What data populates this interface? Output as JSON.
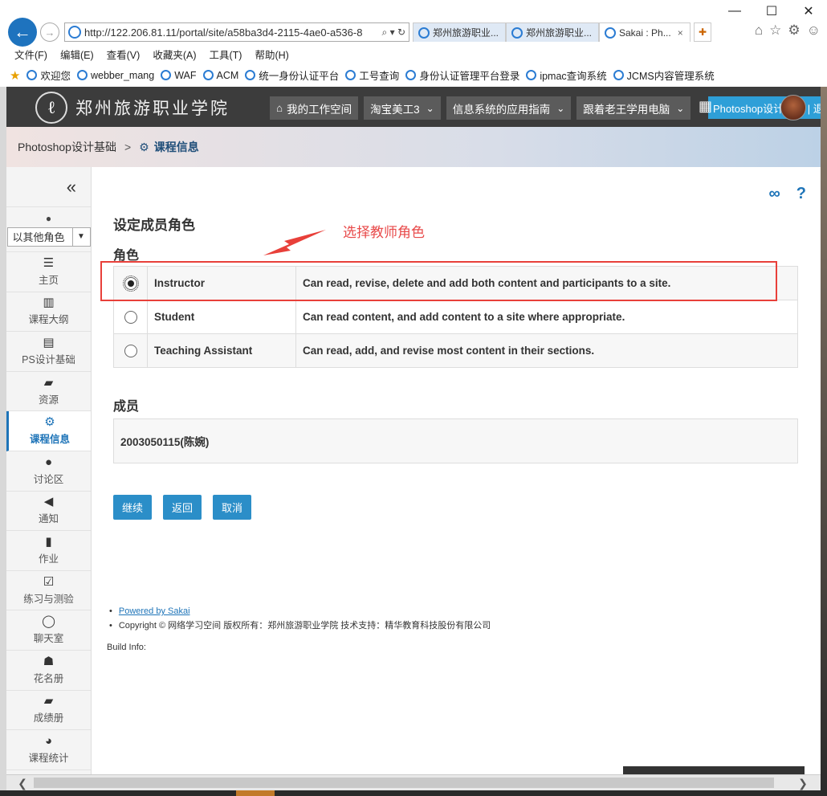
{
  "browser": {
    "url": "http://122.206.81.11/portal/site/a58ba3d4-2115-4ae0-a536-8",
    "address_tools": "⌕ ▾ ↻",
    "tabs": [
      {
        "label": "郑州旅游职业...",
        "close": ""
      },
      {
        "label": "郑州旅游职业...",
        "close": ""
      },
      {
        "label": "Sakai : Ph...",
        "close": "×"
      }
    ],
    "menu": [
      "文件(F)",
      "编辑(E)",
      "查看(V)",
      "收藏夹(A)",
      "工具(T)",
      "帮助(H)"
    ],
    "favorites": [
      "欢迎您",
      "webber_mang",
      "WAF",
      "ACM",
      "统一身份认证平台",
      "工号查询",
      "身份认证管理平台登录",
      "ipmac查询系统",
      "JCMS内容管理系统"
    ]
  },
  "portal": {
    "school_name": "郑州旅游职业学院",
    "site_tabs": [
      {
        "label": "我的工作空间",
        "icon": "home-icon"
      },
      {
        "label": "淘宝美工3",
        "chev": "⌄"
      },
      {
        "label": "信息系统的应用指南",
        "chev": "⌄"
      },
      {
        "label": "跟着老王学用电脑",
        "chev": "⌄"
      }
    ],
    "user_box_text": "Photoshop设计基础 | 退出"
  },
  "breadcrumb": {
    "site": "Photoshop设计基础",
    "separator": ">",
    "current": "课程信息"
  },
  "toolmenu": {
    "role_select": "以其他角色",
    "items": [
      {
        "label": "主页",
        "icon": "list-icon"
      },
      {
        "label": "课程大纲",
        "icon": "map-icon"
      },
      {
        "label": "PS设计基础",
        "icon": "book-icon"
      },
      {
        "label": "资源",
        "icon": "folder-icon"
      },
      {
        "label": "课程信息",
        "icon": "gear-icon",
        "active": true
      },
      {
        "label": "讨论区",
        "icon": "comments-icon"
      },
      {
        "label": "通知",
        "icon": "bullhorn-icon"
      },
      {
        "label": "作业",
        "icon": "file-icon"
      },
      {
        "label": "练习与测验",
        "icon": "check-square-icon"
      },
      {
        "label": "聊天室",
        "icon": "chat-icon"
      },
      {
        "label": "花名册",
        "icon": "users-icon"
      },
      {
        "label": "成绩册",
        "icon": "gradebook-icon"
      },
      {
        "label": "课程统计",
        "icon": "pie-chart-icon"
      }
    ]
  },
  "main": {
    "title": "设定成员角色",
    "role_heading": "角色",
    "annotation": "选择教师角色",
    "roles": [
      {
        "name": "Instructor",
        "desc": "Can read, revise, delete and add both content and participants to a site.",
        "checked": true
      },
      {
        "name": "Student",
        "desc": "Can read content, and add content to a site where appropriate.",
        "checked": false
      },
      {
        "name": "Teaching Assistant",
        "desc": "Can read, add, and revise most content in their sections.",
        "checked": false
      }
    ],
    "members_heading": "成员",
    "member": "2003050115(陈婉)",
    "buttons": {
      "continue": "继续",
      "back": "返回",
      "cancel": "取消"
    },
    "footer": {
      "powered": "Powered by Sakai",
      "copyright": "Copyright © 网络学习空间 版权所有：郑州旅游职业学院 技术支持：精华教育科技股份有限公司",
      "build": "Build Info:"
    }
  },
  "colors": {
    "accent": "#2b8ec8",
    "highlight": "#e8403a",
    "header_bg": "#3c3c3c"
  }
}
